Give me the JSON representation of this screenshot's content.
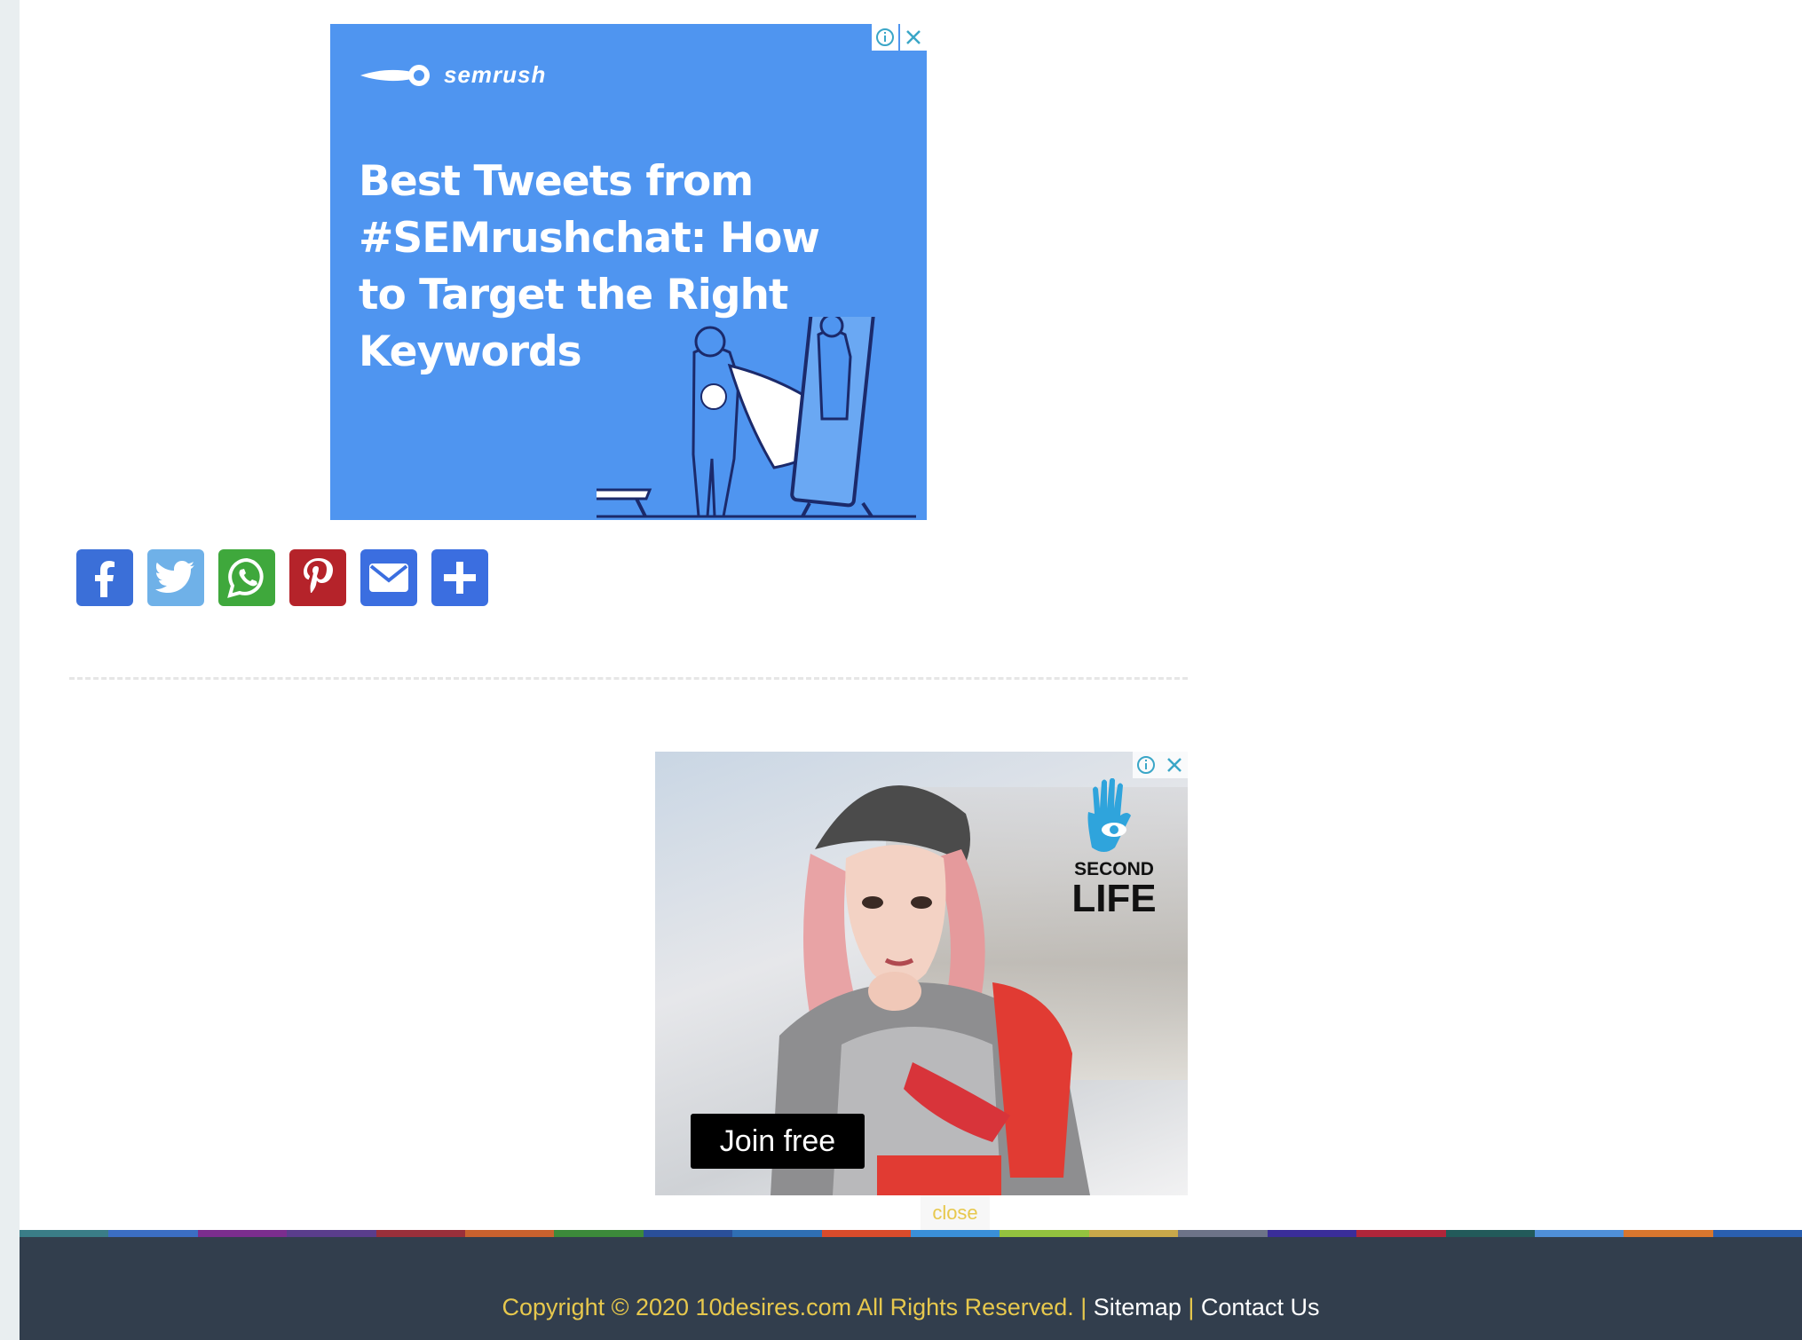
{
  "ad_top": {
    "brand": "semrush",
    "headline": "Best Tweets from #SEMrushchat: How to Target the Right Keywords",
    "background_color": "#4f95f0",
    "icons": [
      "info-icon",
      "close-icon"
    ]
  },
  "share": {
    "buttons": [
      {
        "name": "facebook",
        "color": "#3b6fd8"
      },
      {
        "name": "twitter",
        "color": "#6fb1e8"
      },
      {
        "name": "whatsapp",
        "color": "#3fa83c"
      },
      {
        "name": "pinterest",
        "color": "#b5232a"
      },
      {
        "name": "email",
        "color": "#3b6ee0"
      },
      {
        "name": "share",
        "color": "#3b6ee0"
      }
    ]
  },
  "ad_bottom": {
    "logo_line1": "SECOND",
    "logo_line2": "LIFE",
    "cta": "Join free",
    "icons": [
      "info-icon",
      "close-icon"
    ]
  },
  "close_label": "close",
  "footer": {
    "copyright": "Copyright © 2020 10desires.com All Rights Reserved.",
    "separator": "|",
    "links": [
      "Sitemap",
      "Contact Us"
    ],
    "background_color": "#323e4d",
    "text_color": "#e7c84d",
    "color_bar": [
      "#3a7d87",
      "#3b6ec4",
      "#7b2d8e",
      "#5a3d8c",
      "#9a2f3a",
      "#c8612e",
      "#3c8a3a",
      "#2a4f9a",
      "#2f6fb4",
      "#d94b2b",
      "#3a8fd8",
      "#93c23f",
      "#c9a84a",
      "#6d7388",
      "#3a2d9a",
      "#b0253a",
      "#225a5a",
      "#4f8fd8",
      "#d8762e",
      "#2a5fb0"
    ]
  }
}
